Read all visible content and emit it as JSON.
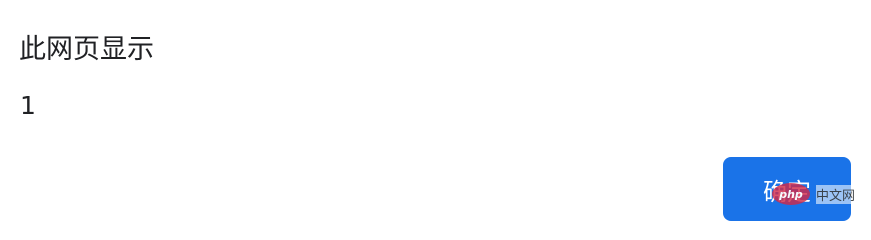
{
  "dialog": {
    "title": "此网页显示",
    "message": "1",
    "ok_label": "确定"
  },
  "watermark": {
    "logo_text": "php",
    "site_text": "中文网"
  },
  "colors": {
    "button_bg": "#1a73e8",
    "button_text": "#ffffff",
    "text": "#202124",
    "background": "#ffffff",
    "watermark_logo": "#d22846"
  }
}
